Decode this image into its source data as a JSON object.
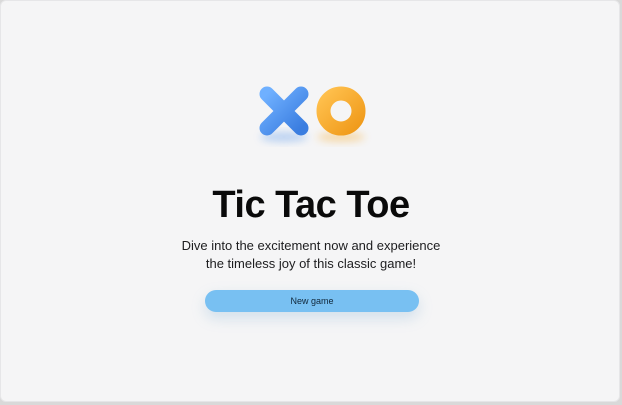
{
  "app": {
    "title": "Tic Tac Toe",
    "subtitle_line1": "Dive into the excitement now and experience",
    "subtitle_line2": "the timeless joy of this classic game!",
    "new_game_label": "New game"
  },
  "logo": {
    "x_icon": "x-mark-icon",
    "o_icon": "o-ring-icon",
    "x_color": "#4f92ea",
    "o_color": "#f5a623"
  },
  "colors": {
    "background": "#f5f5f6",
    "button": "#78c0f2",
    "title": "#0a0a0a"
  }
}
